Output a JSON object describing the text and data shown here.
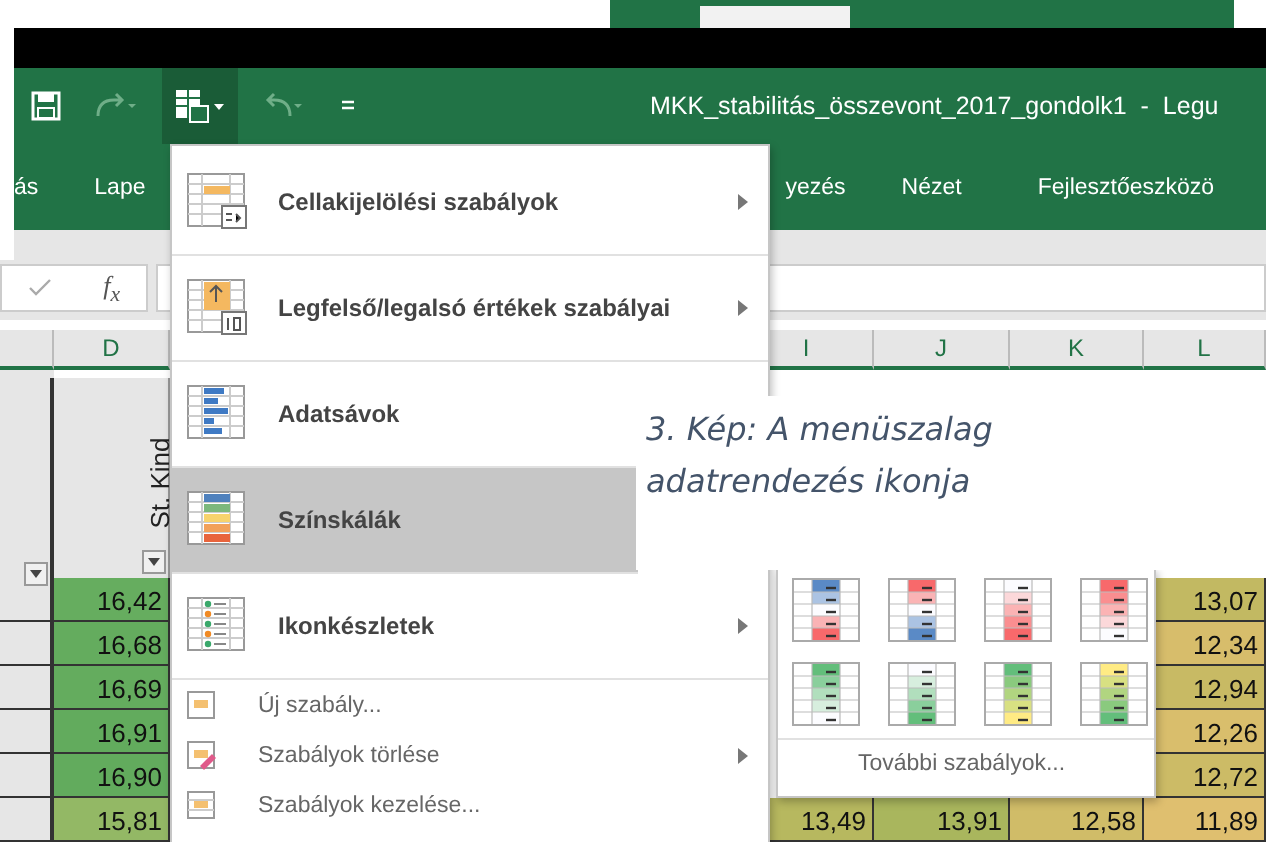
{
  "title_bar": {
    "title": "MKK_stabilitás_összevont_2017_gondolk1  -  Legu"
  },
  "ribbon_tabs": [
    {
      "label": "ás"
    },
    {
      "label": "Lape"
    },
    {
      "label": "yezés"
    },
    {
      "label": "Nézet"
    },
    {
      "label": "Fejlesztőeszközö"
    }
  ],
  "formula_bar": {
    "function_label": "f$_{x}$"
  },
  "sheet": {
    "columns": [
      {
        "header": "D",
        "title": "St. Kind",
        "cells": [
          {
            "value": "16,42",
            "color": "#66ad5f"
          },
          {
            "value": "16,68",
            "color": "#64ac5e"
          },
          {
            "value": "16,69",
            "color": "#64ac5e"
          },
          {
            "value": "16,91",
            "color": "#62ab5d"
          },
          {
            "value": "16,90",
            "color": "#62ab5d"
          },
          {
            "value": "15,81",
            "color": "#93b865"
          }
        ]
      },
      {
        "header": "I",
        "cells": [
          {
            "value": "13,49",
            "color": "#b7b85f"
          }
        ]
      },
      {
        "header": "J",
        "cells": [
          {
            "value": "13,91",
            "color": "#a9b65d"
          }
        ]
      },
      {
        "header": "K",
        "cells": [
          {
            "value": "12,58",
            "color": "#d0bc68"
          }
        ]
      },
      {
        "header": "L",
        "cells": [
          {
            "value": "13,07",
            "color": "#c2b962"
          },
          {
            "value": "12,34",
            "color": "#d7bd6b"
          },
          {
            "value": "12,94",
            "color": "#c8ba64"
          },
          {
            "value": "12,26",
            "color": "#d9be6c"
          },
          {
            "value": "12,72",
            "color": "#ccbb66"
          },
          {
            "value": "11,89",
            "color": "#dfbf6f"
          }
        ]
      }
    ]
  },
  "menu": {
    "items": [
      {
        "kind": "large",
        "label": "Cellakijelölési szabályok",
        "submenu": true,
        "selected": false
      },
      {
        "kind": "large",
        "label": "Legfelső/legalsó értékek szabályai",
        "submenu": true,
        "selected": false
      },
      {
        "kind": "large",
        "label": "Adatsávok",
        "submenu": false,
        "selected": false
      },
      {
        "kind": "large",
        "label": "Színskálák",
        "submenu": false,
        "selected": true
      },
      {
        "kind": "large",
        "label": "Ikonkészletek",
        "submenu": true,
        "selected": false
      },
      {
        "kind": "small",
        "label": "Új szabály...",
        "submenu": false,
        "selected": false
      },
      {
        "kind": "small",
        "label": "Szabályok törlése",
        "submenu": true,
        "selected": false
      },
      {
        "kind": "small",
        "label": "Szabályok kezelése...",
        "submenu": false,
        "selected": false
      }
    ]
  },
  "submenu": {
    "more": "További szabályok..."
  },
  "caption": "3. Kép: A menüszalag adatrendezés ikonja"
}
